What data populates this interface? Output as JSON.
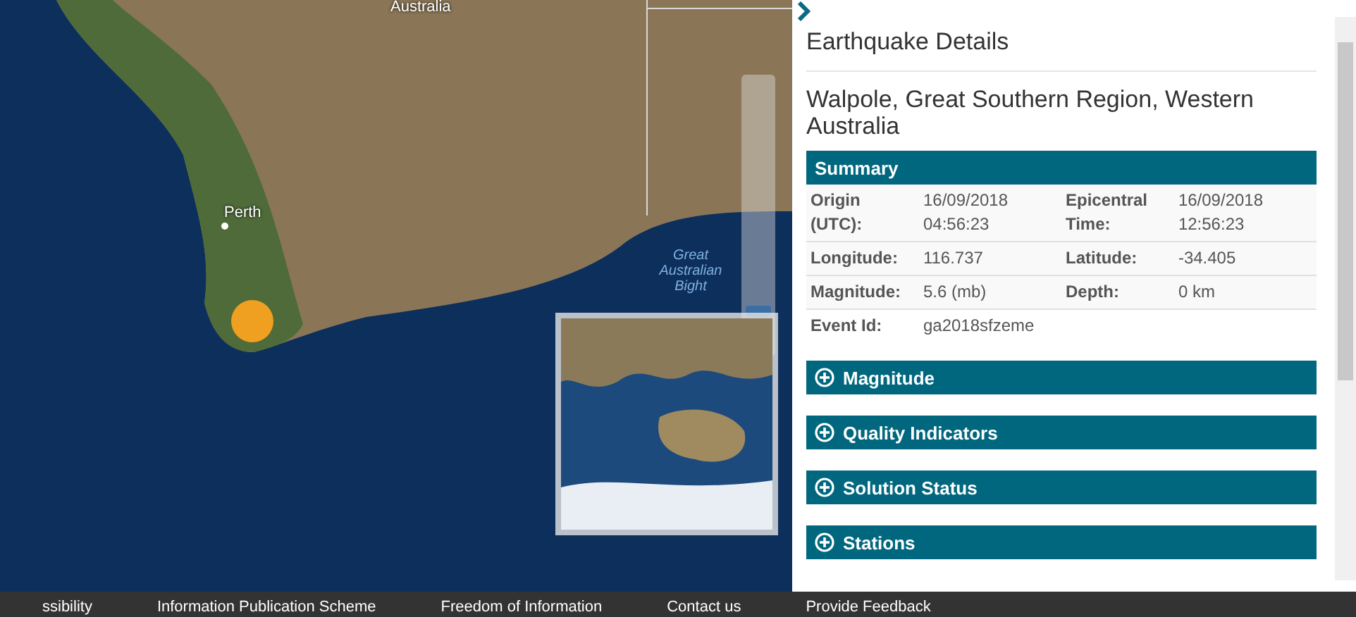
{
  "map": {
    "labels": [
      {
        "text": "Australia",
        "kind": "country"
      },
      {
        "text": "Perth",
        "kind": "city"
      },
      {
        "text": "Great Australian Bight",
        "kind": "water"
      }
    ],
    "slider": {
      "level": 0.1
    }
  },
  "panel": {
    "title": "Earthquake Details",
    "location": "Walpole, Great Southern Region, Western Australia",
    "summary": {
      "heading": "Summary",
      "rows": [
        [
          {
            "label": "Origin (UTC):",
            "value": "16/09/2018 04:56:23"
          },
          {
            "label": "Epicentral Time:",
            "value": "16/09/2018 12:56:23"
          }
        ],
        [
          {
            "label": "Longitude:",
            "value": "116.737"
          },
          {
            "label": "Latitude:",
            "value": "-34.405"
          }
        ],
        [
          {
            "label": "Magnitude:",
            "value": "5.6 (mb)"
          },
          {
            "label": "Depth:",
            "value": "0 km"
          }
        ],
        [
          {
            "label": "Event Id:",
            "value": "ga2018sfzeme"
          }
        ]
      ]
    },
    "sections": [
      {
        "label": "Magnitude",
        "expanded": false
      },
      {
        "label": "Quality Indicators",
        "expanded": false
      },
      {
        "label": "Solution Status",
        "expanded": false
      },
      {
        "label": "Stations",
        "expanded": false
      }
    ]
  },
  "footer": {
    "links": [
      "ssibility",
      "Information Publication Scheme",
      "Freedom of Information",
      "Contact us",
      "Provide Feedback"
    ]
  }
}
